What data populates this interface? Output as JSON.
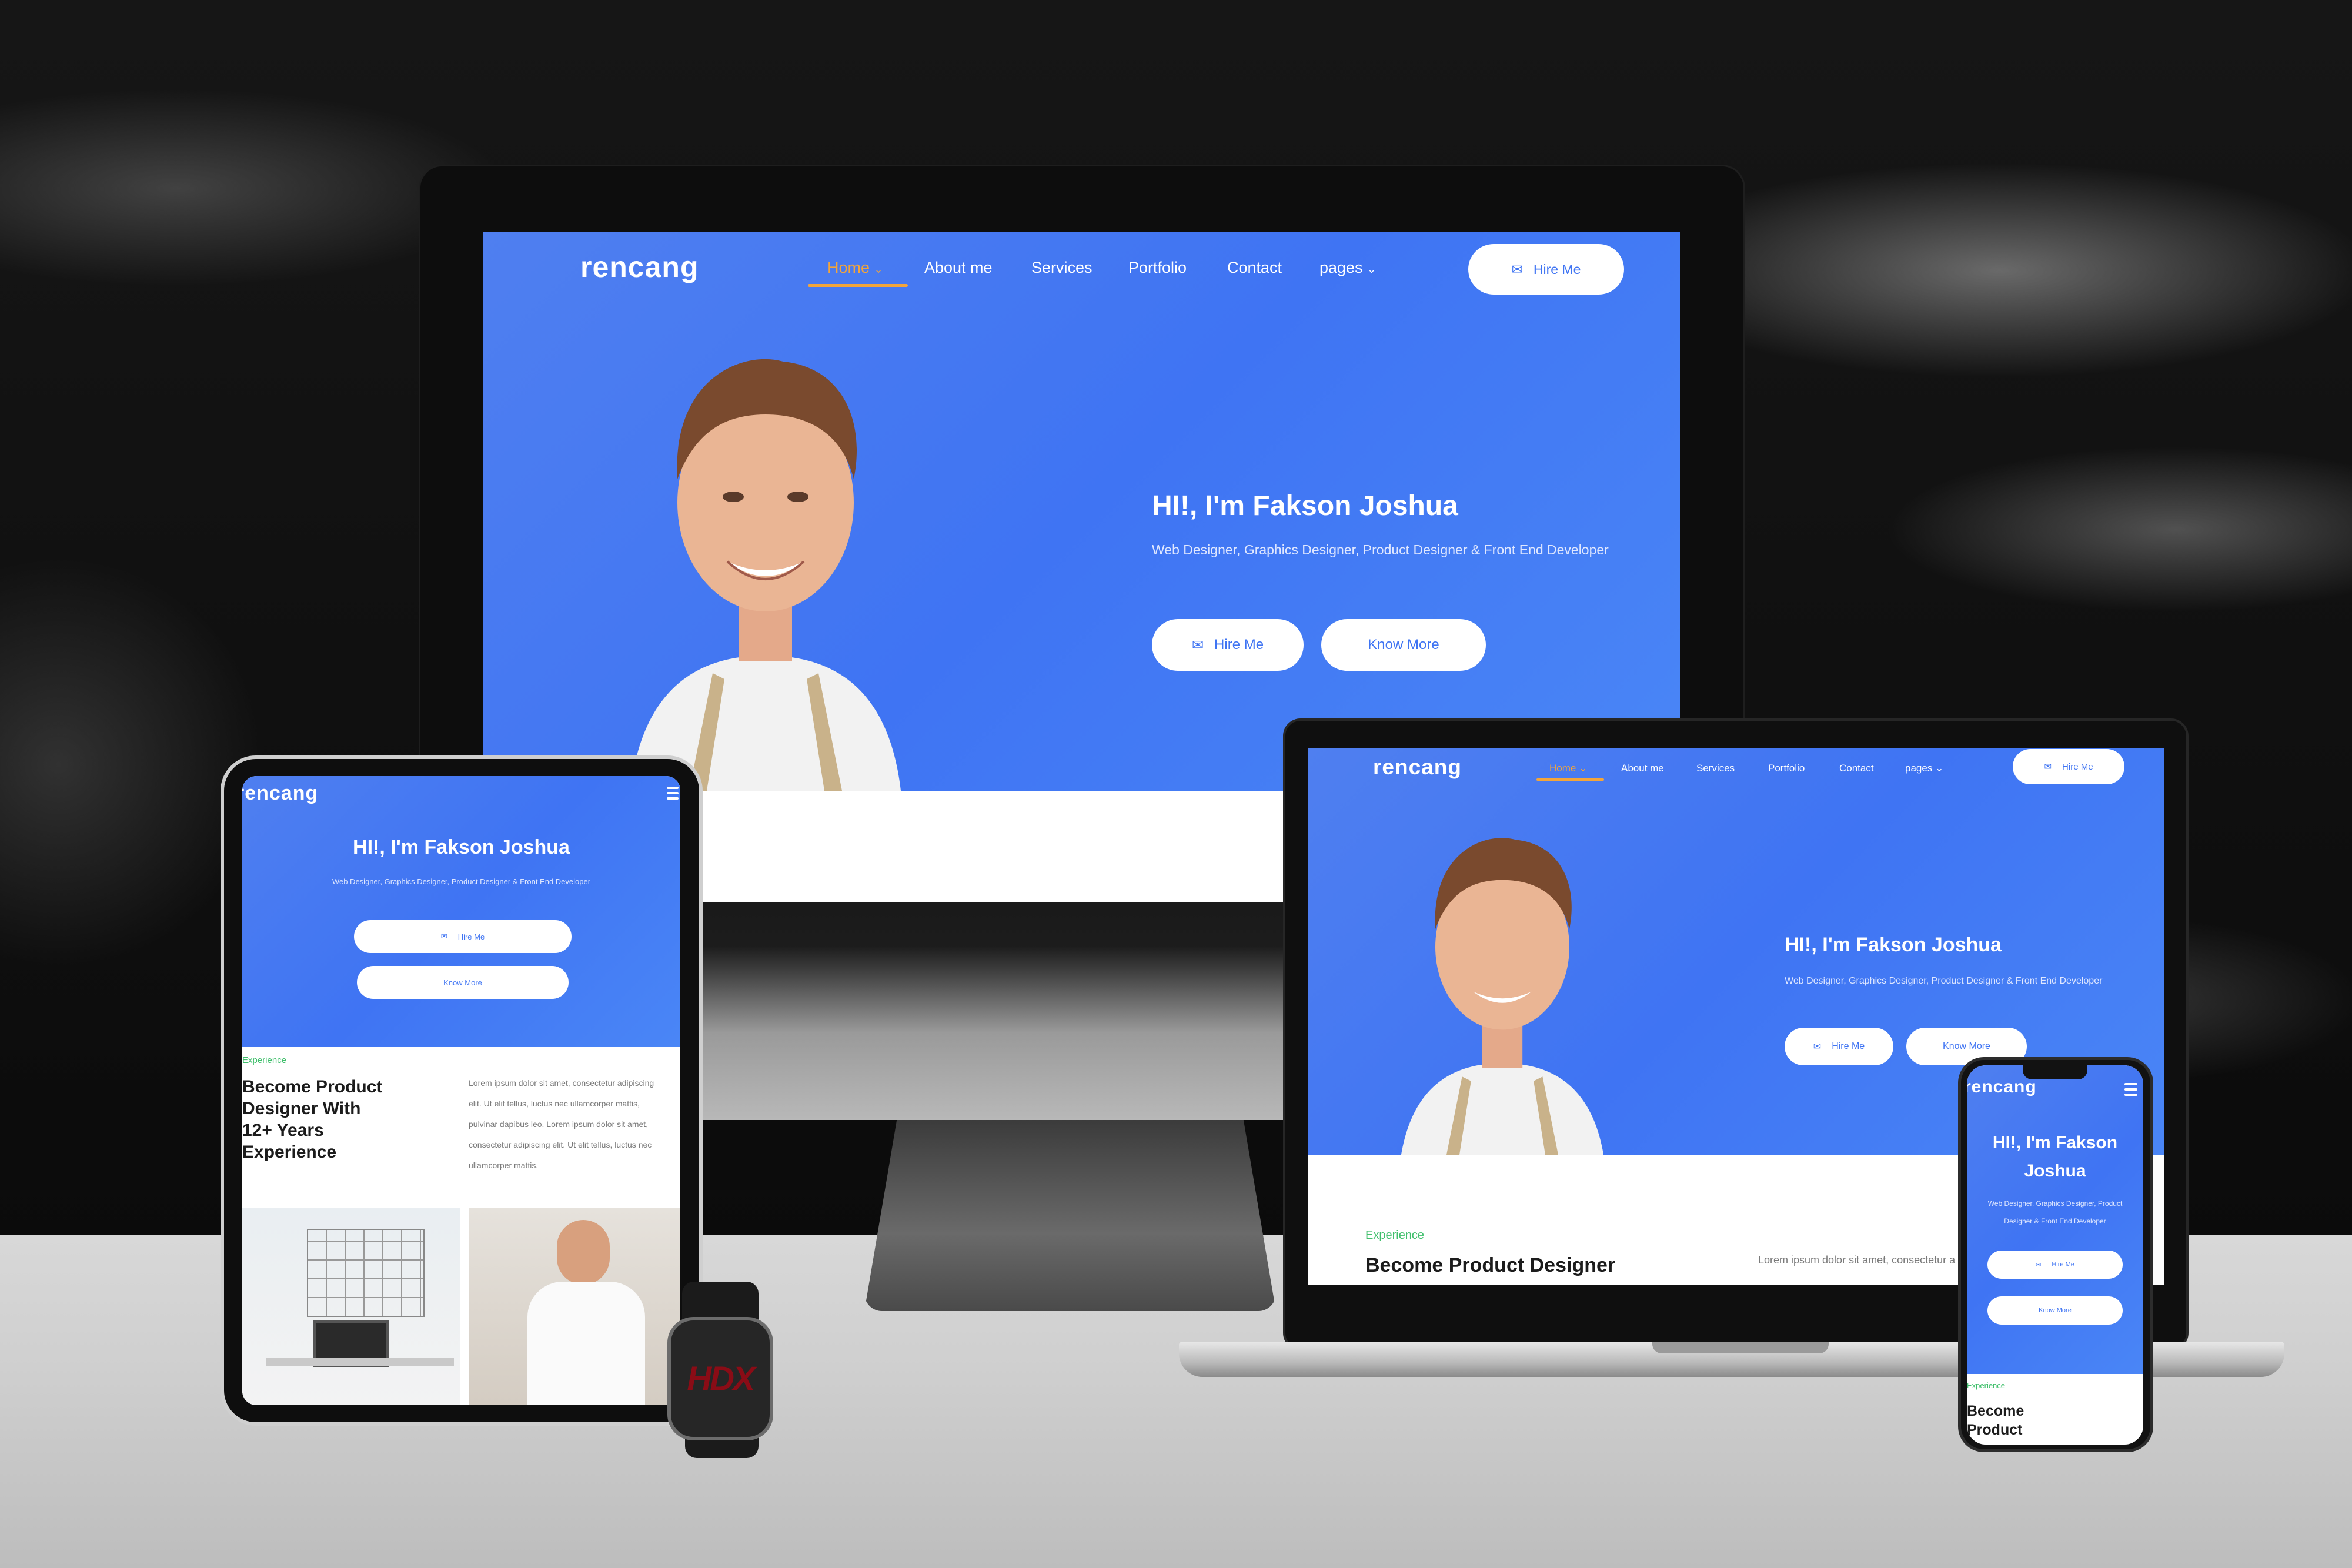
{
  "brand": "rencang",
  "nav": {
    "items": [
      "Home",
      "About me",
      "Services",
      "Portfolio",
      "Contact",
      "pages"
    ],
    "hire_label": "Hire Me"
  },
  "hero": {
    "title": "HI!, I'm Fakson Joshua",
    "title_phone_line1": "HI!, I'm Fakson",
    "title_phone_line2": "Joshua",
    "subtitle": "Web Designer, Graphics Designer, Product Designer & Front End Developer",
    "subtitle_phone_line1": "Web Designer, Graphics Designer, Product",
    "subtitle_phone_line2": "Designer & Front End Developer",
    "hire_button": "Hire Me",
    "know_button": "Know More"
  },
  "experience": {
    "tag": "Experience",
    "laptop_heading": "Become Product Designer",
    "tablet_heading_lines": [
      "Become Product",
      "Designer With",
      "12+ Years",
      "Experience"
    ],
    "phone_heading_lines": [
      "Become",
      "Product"
    ],
    "laptop_body": "Lorem ipsum dolor sit amet, consectetur a",
    "tablet_body_lines": [
      "Lorem ipsum dolor sit amet, consectetur adipiscing",
      "elit. Ut elit tellus, luctus nec ullamcorper mattis,",
      "pulvinar dapibus leo. Lorem ipsum dolor sit amet,",
      "consectetur adipiscing elit. Ut elit tellus, luctus nec",
      "ullamcorper mattis."
    ]
  },
  "watch": {
    "logo": "HDX"
  },
  "colors": {
    "primary_blue": "#3f74f3",
    "accent_orange": "#f3a53a",
    "accent_green": "#3fbf6b"
  }
}
